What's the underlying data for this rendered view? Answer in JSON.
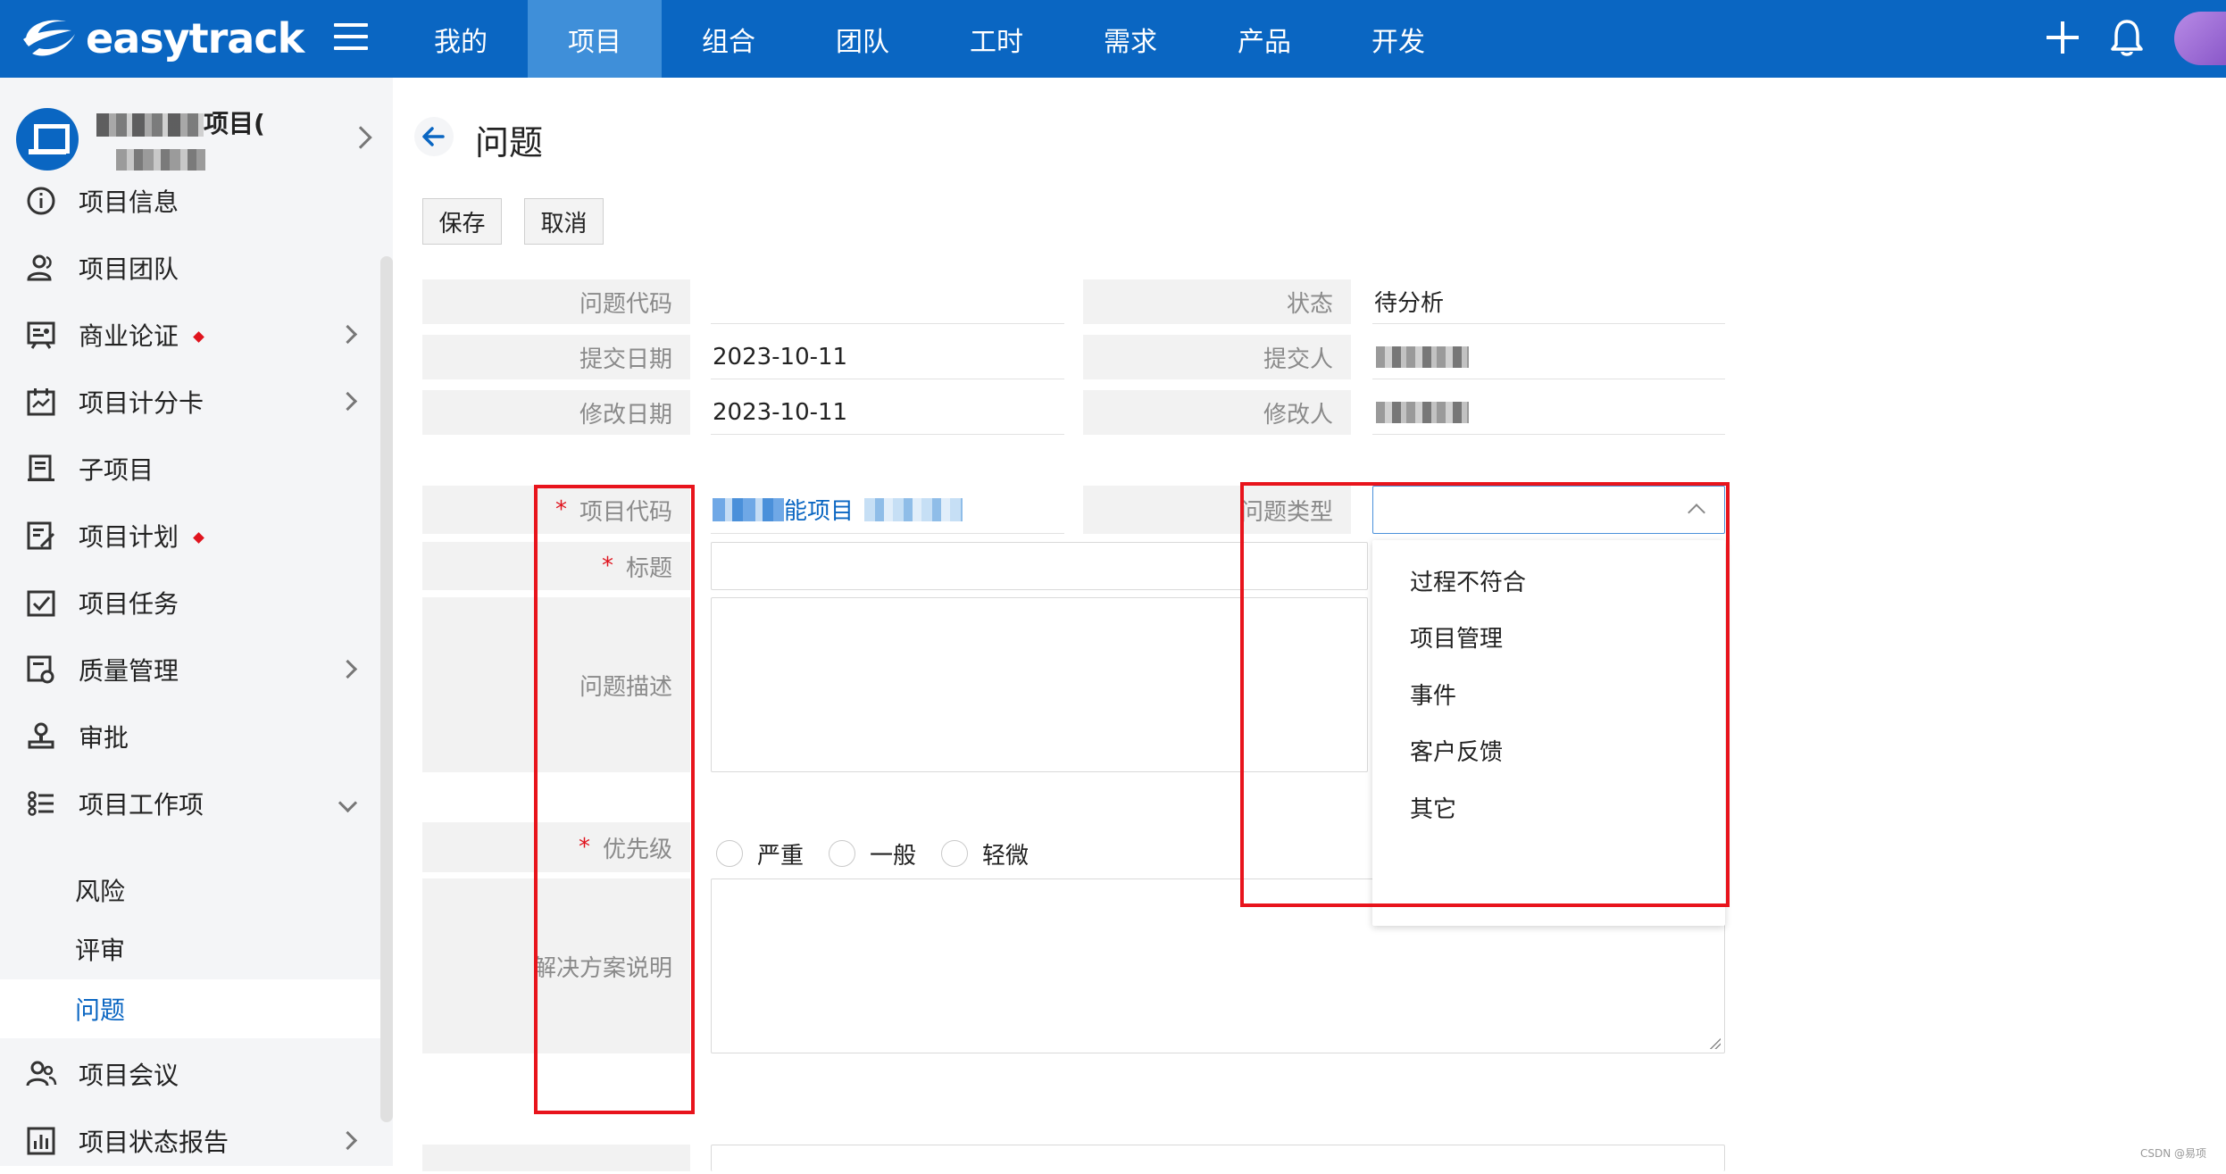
{
  "app": {
    "brand": "easytrack"
  },
  "nav": {
    "items": [
      "我的",
      "项目",
      "组合",
      "团队",
      "工时",
      "需求",
      "产品",
      "开发"
    ],
    "active": "项目"
  },
  "sidebar": {
    "project_name_visible": "项目(",
    "items": [
      {
        "label": "项目信息",
        "icon": "info-icon"
      },
      {
        "label": "项目团队",
        "icon": "team-icon"
      },
      {
        "label": "商业论证",
        "icon": "business-case-icon",
        "dot": true,
        "chevron": true
      },
      {
        "label": "项目计分卡",
        "icon": "scorecard-icon",
        "chevron": true
      },
      {
        "label": "子项目",
        "icon": "subproject-icon"
      },
      {
        "label": "项目计划",
        "icon": "plan-icon",
        "dot": true
      },
      {
        "label": "项目任务",
        "icon": "task-icon"
      },
      {
        "label": "质量管理",
        "icon": "quality-icon",
        "chevron": true
      },
      {
        "label": "审批",
        "icon": "approval-icon"
      },
      {
        "label": "项目工作项",
        "icon": "workitem-icon",
        "expanded": true
      },
      {
        "label": "风险"
      },
      {
        "label": "评审"
      },
      {
        "label": "问题",
        "active": true
      },
      {
        "label": "项目会议",
        "icon": "meeting-icon"
      },
      {
        "label": "项目状态报告",
        "icon": "report-icon",
        "chevron": true
      }
    ]
  },
  "page": {
    "title": "问题",
    "save_label": "保存",
    "cancel_label": "取消"
  },
  "form": {
    "issue_code": {
      "label": "问题代码",
      "value": ""
    },
    "status": {
      "label": "状态",
      "value": "待分析"
    },
    "submit_date": {
      "label": "提交日期",
      "value": "2023-10-11"
    },
    "submitter": {
      "label": "提交人",
      "value": ""
    },
    "modify_date": {
      "label": "修改日期",
      "value": "2023-10-11"
    },
    "modifier": {
      "label": "修改人",
      "value": ""
    },
    "project_code": {
      "label": "项目代码",
      "value_visible": "能项目",
      "required": true
    },
    "issue_type": {
      "label": "问题类型",
      "value": "",
      "options": [
        "过程不符合",
        "项目管理",
        "事件",
        "客户反馈",
        "其它"
      ]
    },
    "title": {
      "label": "标题",
      "value": "",
      "required": true
    },
    "description": {
      "label": "问题描述",
      "value": ""
    },
    "priority": {
      "label": "优先级",
      "required": true,
      "options": [
        "严重",
        "一般",
        "轻微"
      ],
      "selected": null
    },
    "solution": {
      "label": "解决方案说明",
      "value": ""
    }
  },
  "colors": {
    "brand": "#0a66c2",
    "nav_active": "#3f8fd9",
    "required": "#e0141e",
    "highlight": "#e8141c"
  },
  "watermark": "CSDN @易项"
}
